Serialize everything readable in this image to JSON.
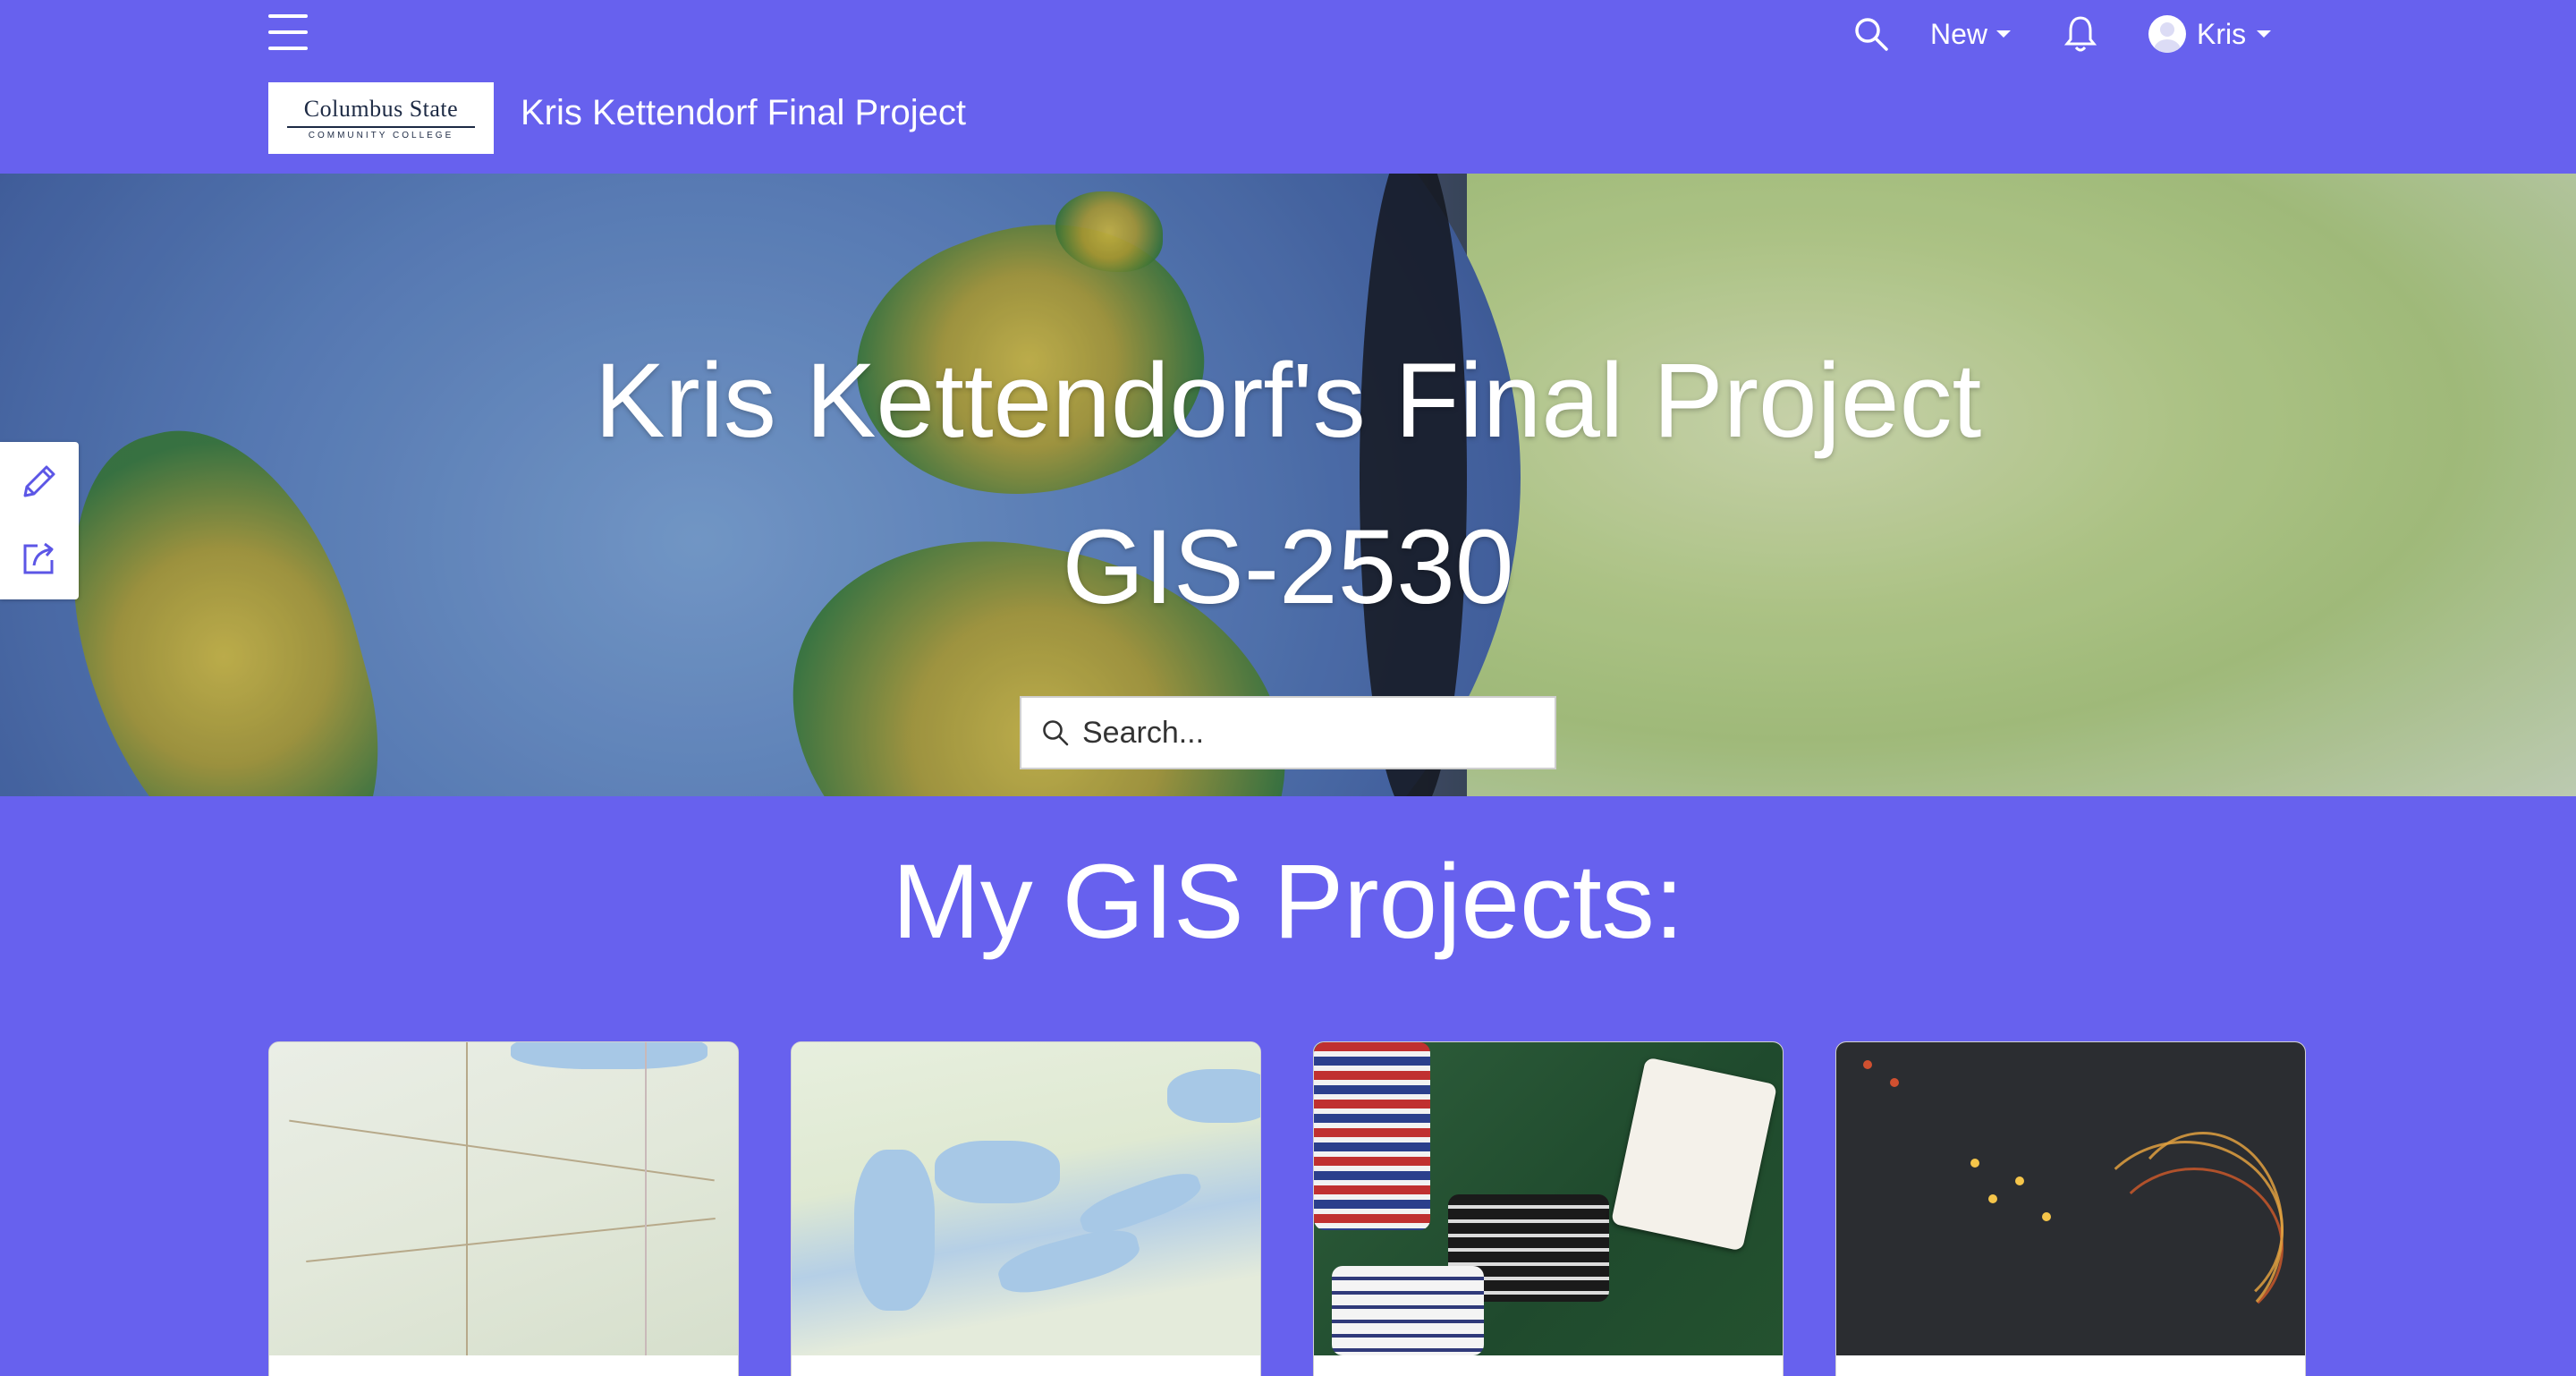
{
  "header": {
    "menu_icon": "hamburger-menu-icon",
    "search_icon": "search-icon",
    "new_label": "New",
    "notifications_icon": "bell-icon",
    "user_name": "Kris",
    "logo": {
      "main": "Columbus State",
      "sub": "COMMUNITY COLLEGE"
    },
    "site_title": "Kris Kettendorf Final Project"
  },
  "hero": {
    "title_line1": "Kris Kettendorf's Final Project",
    "title_line2": "GIS-2530",
    "search_placeholder": "Search..."
  },
  "side_tools": {
    "edit_icon": "pencil-icon",
    "share_icon": "share-icon"
  },
  "projects": {
    "heading": "My GIS Projects:",
    "cards": [
      {
        "thumbnail": "ohio-road-map"
      },
      {
        "thumbnail": "great-lakes-northeast-map"
      },
      {
        "thumbnail": "casino-poker-chips-photo"
      },
      {
        "thumbnail": "us-hurricane-tracks-dark-map"
      }
    ]
  },
  "colors": {
    "brand_background": "#6761ee",
    "text": "#ffffff"
  }
}
